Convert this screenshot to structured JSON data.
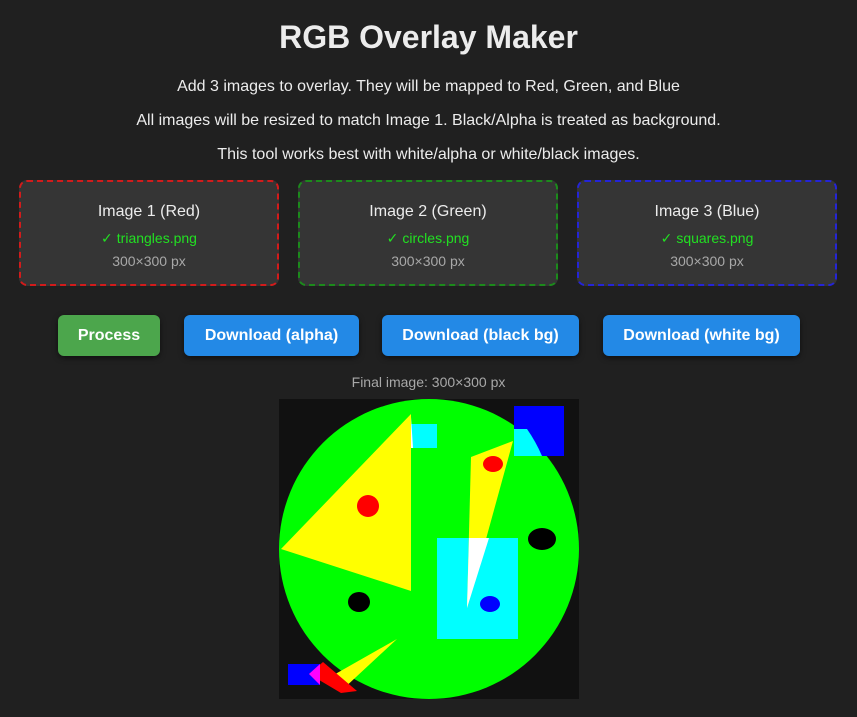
{
  "app": {
    "title": "RGB Overlay Maker",
    "description_lines": [
      "Add 3 images to overlay. They will be mapped to Red, Green, and Blue",
      "All images will be resized to match Image 1. Black/Alpha is treated as background.",
      "This tool works best with white/alpha or white/black images."
    ]
  },
  "slots": [
    {
      "label": "Image 1 (Red)",
      "check": "✓",
      "filename": "triangles.png",
      "size": "300×300 px",
      "border_color": "#d21b1b"
    },
    {
      "label": "Image 2 (Green)",
      "check": "✓",
      "filename": "circles.png",
      "size": "300×300 px",
      "border_color": "#1c8a1c"
    },
    {
      "label": "Image 3 (Blue)",
      "check": "✓",
      "filename": "squares.png",
      "size": "300×300 px",
      "border_color": "#2424d8"
    }
  ],
  "actions": {
    "process": "Process",
    "download_alpha": "Download (alpha)",
    "download_black": "Download (black bg)",
    "download_white": "Download (white bg)"
  },
  "result": {
    "caption": "Final image: 300×300 px"
  },
  "colors": {
    "background": "#202020",
    "panel": "#353535",
    "process_button": "#4ca64c",
    "download_button": "#2389e6",
    "file_ok": "#22e022"
  }
}
